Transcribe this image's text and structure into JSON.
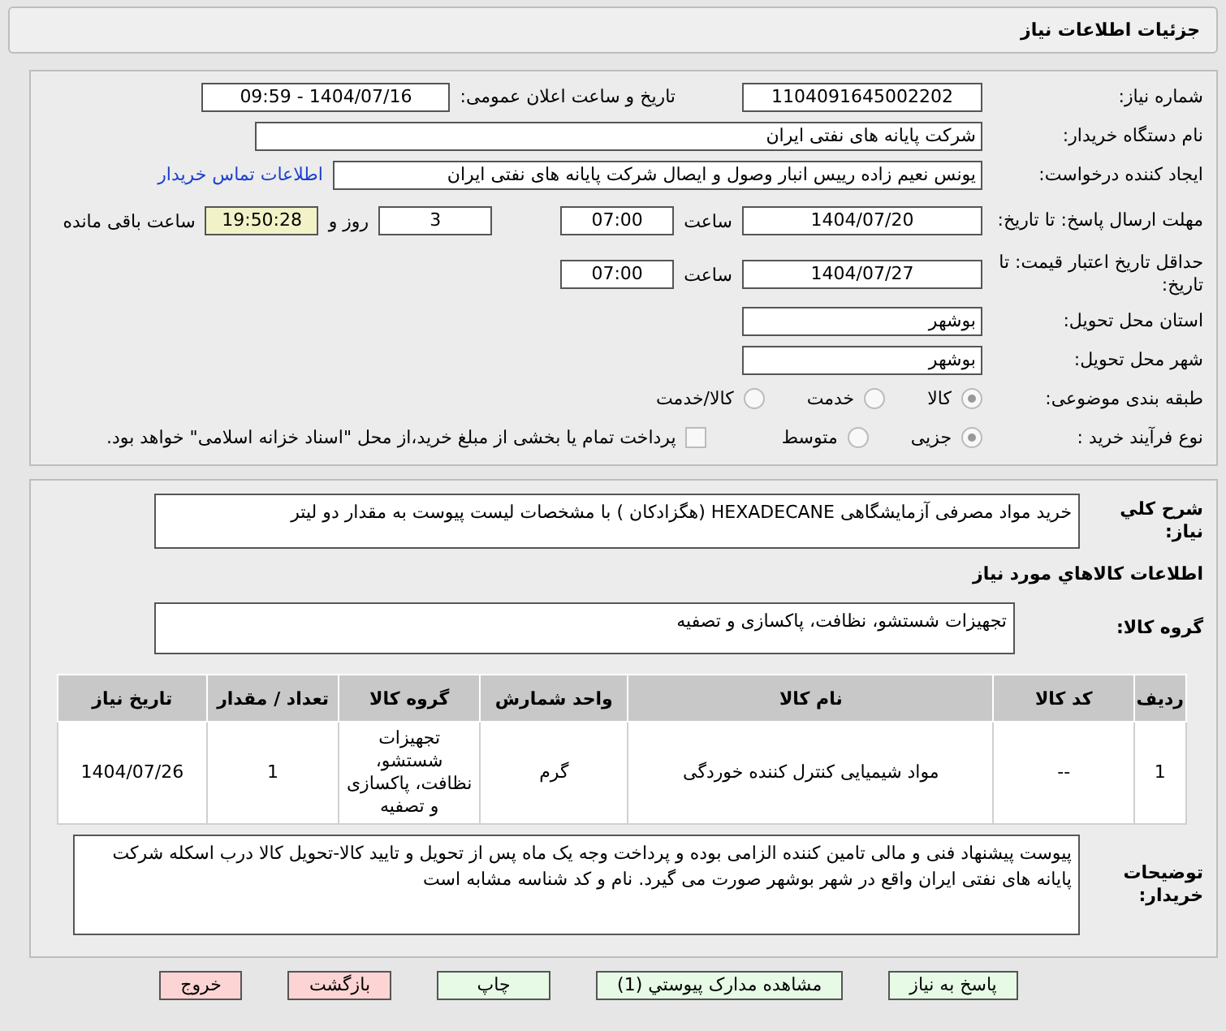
{
  "header": {
    "title": "جزئیات اطلاعات نیاز"
  },
  "need_number": {
    "label": "شماره نیاز:",
    "value": "1104091645002202"
  },
  "announce": {
    "label": "تاریخ و ساعت اعلان عمومی:",
    "value": "1404/07/16 - 09:59"
  },
  "buyer_org": {
    "label": "نام دستگاه خریدار:",
    "value": "شرکت پایانه های نفتی ایران"
  },
  "requester": {
    "label": "ایجاد کننده درخواست:",
    "value": "یونس نعیم زاده رییس انبار وصول و ایصال شرکت پایانه های نفتی ایران",
    "link": "اطلاعات تماس خریدار"
  },
  "deadline": {
    "label": "مهلت ارسال پاسخ: تا تاریخ:",
    "date": "1404/07/20",
    "time_label": "ساعت",
    "time": "07:00",
    "days": "3",
    "days_label": "روز و",
    "remaining": "19:50:28",
    "remaining_label": "ساعت باقی مانده"
  },
  "validity": {
    "label": "حداقل تاریخ اعتبار قیمت: تا تاریخ:",
    "date": "1404/07/27",
    "time_label": "ساعت",
    "time": "07:00"
  },
  "province": {
    "label": "استان محل تحویل:",
    "value": "بوشهر"
  },
  "city": {
    "label": "شهر محل تحویل:",
    "value": "بوشهر"
  },
  "category": {
    "label": "طبقه بندی موضوعی:",
    "options": [
      {
        "label": "کالا",
        "selected": true
      },
      {
        "label": "خدمت",
        "selected": false
      },
      {
        "label": "کالا/خدمت",
        "selected": false
      }
    ]
  },
  "process": {
    "label": "نوع فرآیند خرید :",
    "options": [
      {
        "label": "جزیی",
        "selected": true
      },
      {
        "label": "متوسط",
        "selected": false
      }
    ],
    "payment_checkbox": {
      "checked": false,
      "label": "پرداخت تمام یا بخشی از مبلغ خرید،از محل \"اسناد خزانه اسلامی\" خواهد بود."
    }
  },
  "summary": {
    "label": "شرح کلي نياز:",
    "value": "خرید مواد مصرفی آزمایشگاهی HEXADECANE (هگزادکان ) با مشخصات لیست پیوست به مقدار دو لیتر"
  },
  "goods_title": "اطلاعات کالاهاي مورد نياز",
  "goods_group": {
    "label": "گروه کالا:",
    "value": "تجهیزات شستشو، نظافت، پاکسازی و تصفیه"
  },
  "table": {
    "columns": [
      "ردیف",
      "کد کالا",
      "نام کالا",
      "واحد شمارش",
      "گروه کالا",
      "تعداد / مقدار",
      "تاریخ نیاز"
    ],
    "rows": [
      [
        "1",
        "--",
        "مواد شیمیایی کنترل کننده خوردگی",
        "گرم",
        "تجهیزات شستشو، نظافت، پاکسازی و تصفیه",
        "1",
        "1404/07/26"
      ]
    ]
  },
  "buyer_notes": {
    "label": "توضیحات خریدار:",
    "value": "پیوست پیشنهاد فنی و مالی تامین کننده الزامی بوده و پرداخت وجه یک ماه پس از تحویل و تایید کالا-تحویل کالا درب اسکله شرکت پایانه های نفتی ایران واقع در شهر بوشهر صورت می گیرد. نام و کد شناسه مشابه است"
  },
  "buttons": [
    {
      "label": "پاسخ به نیاز",
      "kind": "normal"
    },
    {
      "label": "مشاهده مدارک پیوستي (1)",
      "kind": "normal"
    },
    {
      "label": "چاپ",
      "kind": "normal"
    },
    {
      "label": "بازگشت",
      "kind": "danger"
    },
    {
      "label": "خروج",
      "kind": "danger"
    }
  ]
}
